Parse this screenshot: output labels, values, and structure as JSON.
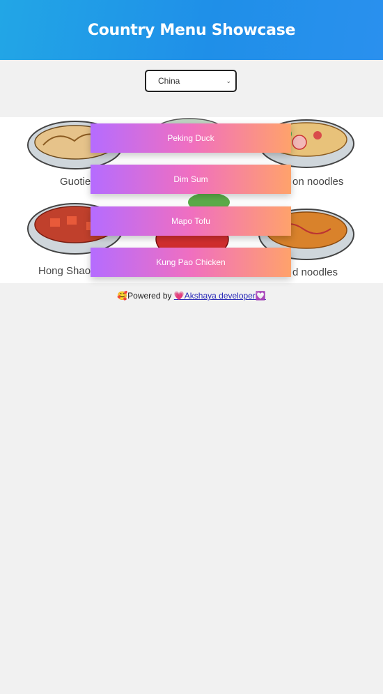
{
  "header": {
    "title": "Country Menu Showcase"
  },
  "country_select": {
    "selected": "China"
  },
  "banner": {
    "labels": [
      "Guotie",
      "on noodles",
      "Hong Shao",
      "d noodles"
    ]
  },
  "dishes": [
    {
      "label": "Peking Duck"
    },
    {
      "label": "Dim Sum"
    },
    {
      "label": "Mapo Tofu"
    },
    {
      "label": "Kung Pao Chicken"
    }
  ],
  "footer": {
    "emoji_prefix": "🥰",
    "text": "Powered by ",
    "link_text": "💗Akshaya developer💟"
  },
  "colors": {
    "header_bg": "#1f8fe8",
    "button_gradient_start": "#b56cff",
    "button_gradient_mid": "#f06fc0",
    "button_gradient_end": "#ffa26b",
    "page_bg": "#f1f1f1"
  }
}
